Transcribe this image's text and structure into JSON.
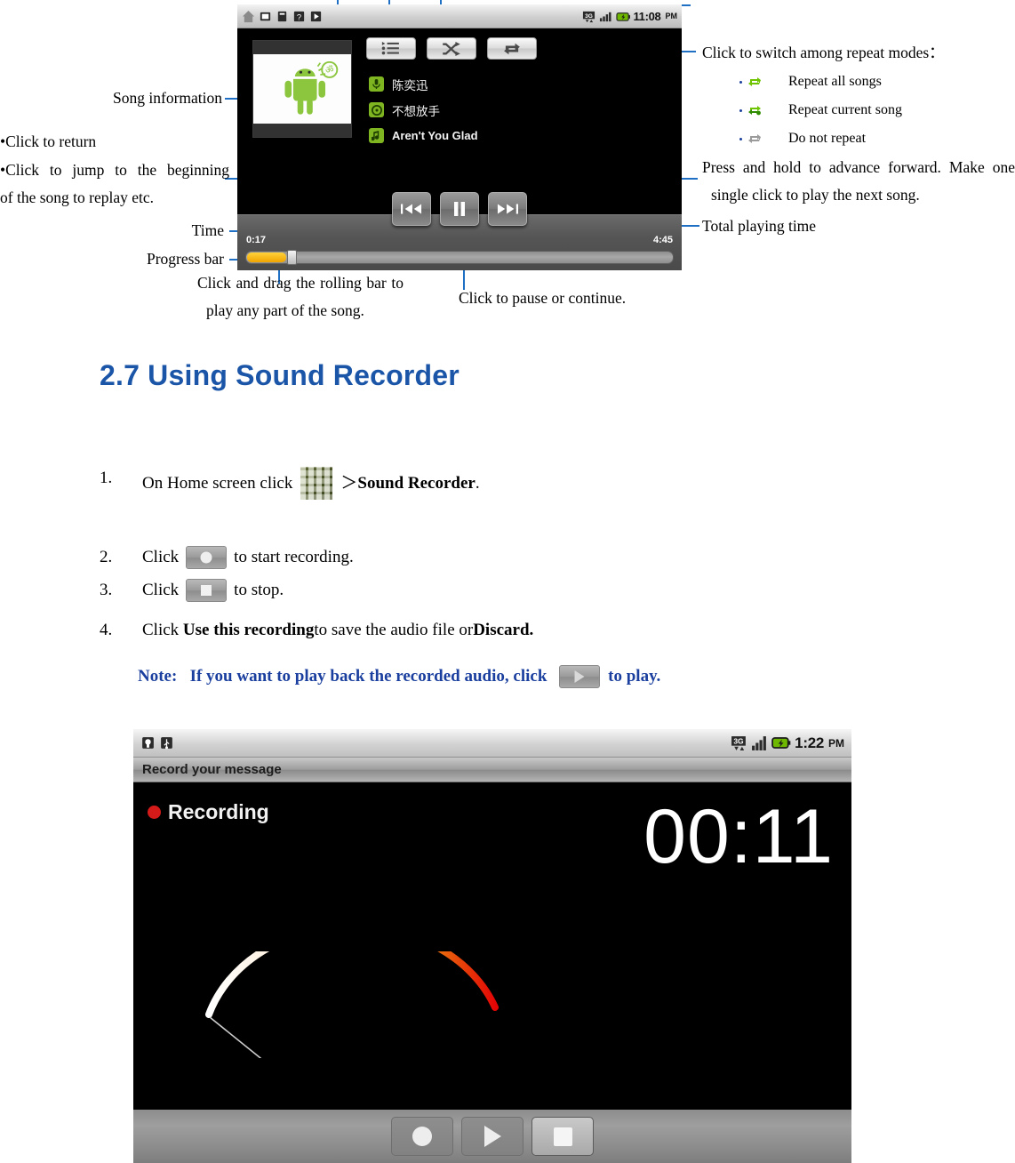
{
  "player_screenshot": {
    "statusbar": {
      "left_icons": [
        "home-icon",
        "sd-card-icon",
        "sim-icon",
        "map-icon",
        "play-icon"
      ],
      "right_icons": [
        "network-3g-icon",
        "signal-bars-icon",
        "battery-icon"
      ],
      "time": "11:08",
      "ampm": "PM"
    },
    "toolbar_buttons": [
      {
        "name": "playlist-button",
        "icon": "playlist-icon"
      },
      {
        "name": "shuffle-button",
        "icon": "shuffle-icon"
      },
      {
        "name": "repeat-button",
        "icon": "repeat-icon"
      }
    ],
    "song": {
      "artist": "陈奕迅",
      "album": "不想放手",
      "track": "Aren't You Glad"
    },
    "controls": {
      "previous": "previous-track-button",
      "pause": "pause-button",
      "next": "next-track-button"
    },
    "elapsed_time": "0:17",
    "total_time": "4:45",
    "progress_percent": 9
  },
  "annotations": {
    "song_information": "Song information",
    "click_to_return": "•Click to return",
    "click_to_jump": "•Click to jump to the beginning",
    "click_to_jump_2": "of the song to replay etc.",
    "time": "Time",
    "progress_bar": "Progress bar",
    "drag_rolling_bar": "Click and drag the rolling bar to",
    "drag_rolling_bar_2": "play any part of the song.",
    "click_pause": "Click to pause or continue.",
    "repeat_modes_title": "Click to switch among repeat modes：",
    "repeat_modes": [
      {
        "icon": "repeat-all-icon",
        "label": "Repeat all songs"
      },
      {
        "icon": "repeat-one-icon",
        "label": "Repeat current song"
      },
      {
        "icon": "repeat-off-icon",
        "label": "Do not repeat"
      }
    ],
    "press_hold": "Press and hold to advance forward. Make one",
    "press_hold_2": "single click to play the next song.",
    "total_playing_time": "Total playing time"
  },
  "section": {
    "heading": "2.7 Using Sound Recorder"
  },
  "steps": [
    {
      "num": "1.",
      "pre": "On Home screen click",
      "icon": "app-launcher-icon",
      "post_plain": "＞",
      "post_bold": "Sound Recorder",
      "tail": "."
    },
    {
      "num": "2.",
      "pre": "Click",
      "icon": "record-button-icon",
      "post_plain": "to start recording.",
      "post_bold": "",
      "tail": ""
    },
    {
      "num": "3.",
      "pre": "Click",
      "icon": "stop-button-icon",
      "post_plain": "to stop.",
      "post_bold": "",
      "tail": ""
    },
    {
      "num": "4.",
      "pre": "Click",
      "icon": "",
      "post_plain": "",
      "post_bold": "Use this recording",
      "tail": ""
    }
  ],
  "step4": {
    "bold_1": "Use this recording",
    "mid": " to save the audio file or ",
    "bold_2": "Discard."
  },
  "note": {
    "label": "Note:",
    "text": "If you want to play back the recorded audio, click",
    "icon": "play-button-icon",
    "tail": "to play."
  },
  "recorder_screenshot": {
    "statusbar": {
      "left_icons": [
        "android-debug-icon",
        "usb-icon"
      ],
      "right_icons": [
        "network-3g-icon",
        "signal-bars-icon",
        "battery-icon"
      ],
      "time": "1:22",
      "ampm": "PM"
    },
    "title": "Record your message",
    "status_label": "Recording",
    "timer": "00:11",
    "vu_meter": "vu-meter-gauge",
    "buttons": [
      {
        "name": "record-button",
        "icon": "record-circle-icon",
        "active": false
      },
      {
        "name": "play-button",
        "icon": "play-triangle-icon",
        "active": false
      },
      {
        "name": "stop-button",
        "icon": "stop-square-icon",
        "active": true
      }
    ]
  },
  "colors": {
    "heading_blue": "#1a55a8",
    "note_blue": "#1a3f9e",
    "callout_blue": "#1f6fc4",
    "progress_orange": "#f0a400",
    "android_green": "#7fb520",
    "record_red": "#d51a1a"
  }
}
